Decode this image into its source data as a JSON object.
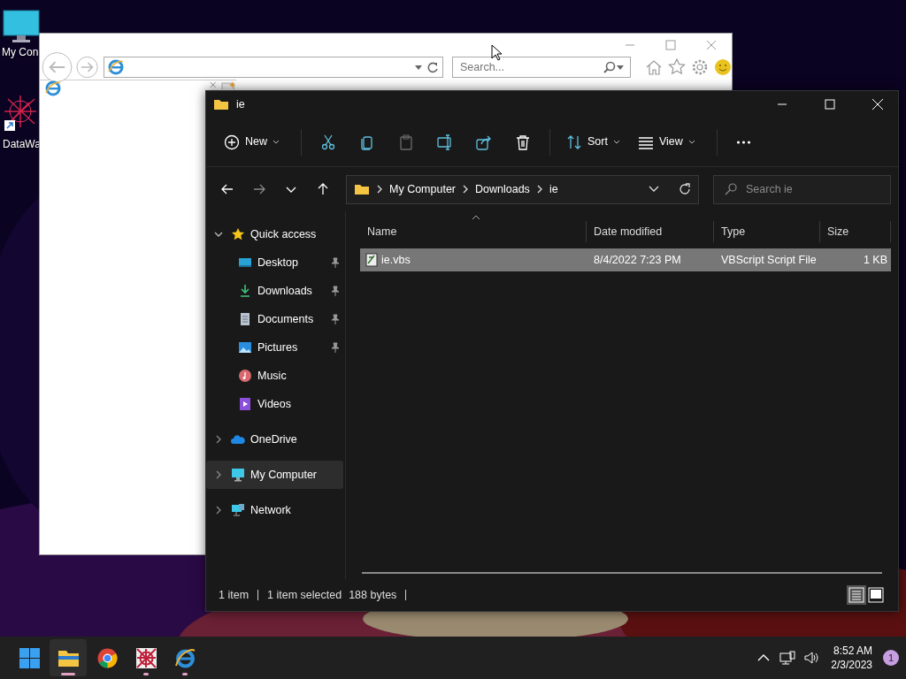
{
  "desktop_icons": [
    {
      "label": "My Con",
      "kind": "computer"
    },
    {
      "label": "DataWa",
      "kind": "app"
    }
  ],
  "browser": {
    "search": {
      "placeholder": "Search..."
    }
  },
  "explorer": {
    "title": "ie",
    "toolbar": [
      {
        "kind": "new",
        "label": "New",
        "disabled": false
      },
      {
        "kind": "cut",
        "disabled": false
      },
      {
        "kind": "copy",
        "disabled": false
      },
      {
        "kind": "paste",
        "disabled": true
      },
      {
        "kind": "rename",
        "disabled": false
      },
      {
        "kind": "share",
        "disabled": false
      },
      {
        "kind": "delete",
        "disabled": false
      },
      {
        "kind": "sort",
        "label": "Sort",
        "disabled": false
      },
      {
        "kind": "view",
        "label": "View",
        "disabled": false
      },
      {
        "kind": "more",
        "disabled": false
      }
    ],
    "breadcrumb": [
      "My Computer",
      "Downloads",
      "ie"
    ],
    "search": {
      "placeholder": "Search ie"
    },
    "nav": [
      {
        "label": "Quick access",
        "kind": "star",
        "expanded": true,
        "selected": false,
        "children": [
          {
            "label": "Desktop",
            "kind": "desktop",
            "pinned": true,
            "selected": false
          },
          {
            "label": "Downloads",
            "kind": "downloads",
            "pinned": true,
            "selected": false
          },
          {
            "label": "Documents",
            "kind": "documents",
            "pinned": true,
            "selected": false
          },
          {
            "label": "Pictures",
            "kind": "pictures",
            "pinned": true,
            "selected": false
          },
          {
            "label": "Music",
            "kind": "music",
            "pinned": false,
            "selected": false
          },
          {
            "label": "Videos",
            "kind": "videos",
            "pinned": false,
            "selected": false
          }
        ]
      },
      {
        "label": "OneDrive",
        "kind": "cloud",
        "expanded": false,
        "selected": false
      },
      {
        "label": "My Computer",
        "kind": "computer",
        "expanded": false,
        "selected": true
      },
      {
        "label": "Network",
        "kind": "network",
        "expanded": false,
        "selected": false
      }
    ],
    "columns": [
      "Name",
      "Date modified",
      "Type",
      "Size"
    ],
    "rows": [
      {
        "name": "ie.vbs",
        "date": "8/4/2022 7:23 PM",
        "type": "VBScript Script File",
        "size": "1 KB",
        "selected": true
      }
    ],
    "status": [
      "1 item",
      "1 item selected",
      "188 bytes"
    ],
    "views": [
      {
        "kind": "details",
        "selected": true
      },
      {
        "kind": "tiles",
        "selected": false
      }
    ]
  },
  "taskbar": {
    "apps": [
      {
        "kind": "start",
        "running": false,
        "selected": false
      },
      {
        "kind": "explorer",
        "running": true,
        "selected": true
      },
      {
        "kind": "chrome",
        "running": false,
        "selected": false
      },
      {
        "kind": "app",
        "running": true,
        "selected": false
      },
      {
        "kind": "ie",
        "running": true,
        "selected": false
      }
    ],
    "time": "8:52 AM",
    "date": "2/3/2023",
    "notifications": "1"
  }
}
